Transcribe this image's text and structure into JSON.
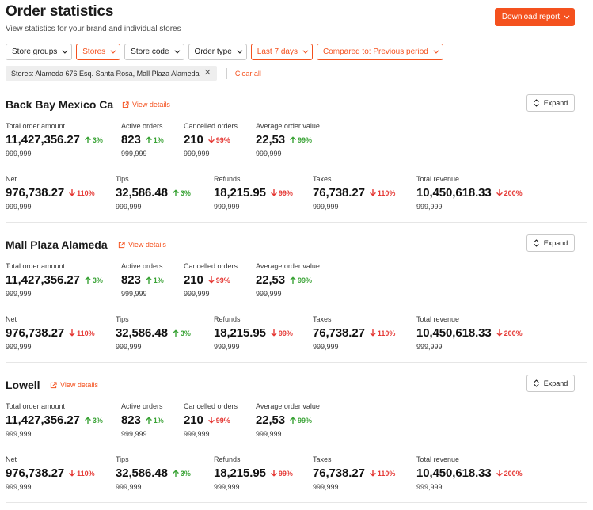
{
  "header": {
    "title": "Order statistics",
    "subtitle": "View statistics for your brand and individual stores",
    "download_label": "Download report"
  },
  "filters": [
    {
      "label": "Store groups",
      "active": false
    },
    {
      "label": "Stores",
      "active": true
    },
    {
      "label": "Store code",
      "active": false
    },
    {
      "label": "Order type",
      "active": false
    },
    {
      "label": "Last 7 days",
      "active": true
    },
    {
      "prefix": "Compared to:",
      "label": "Previous period",
      "active": true
    }
  ],
  "selected_chip": "Stores: Alameda 676 Esq. Santa Rosa, Mall Plaza Alameda",
  "clear_all_label": "Clear all",
  "view_details_label": "View details",
  "expand_label": "Expand",
  "colors": {
    "accent": "#f4511e",
    "positive": "#3aa336",
    "negative": "#e53935"
  },
  "stores": [
    {
      "name": "Back Bay Mexico Ca",
      "row1": [
        {
          "label": "Total order amount",
          "value": "11,427,356.27",
          "change": "3%",
          "dir": "up",
          "sub": "999,999"
        },
        {
          "label": "Active orders",
          "value": "823",
          "change": "1%",
          "dir": "up",
          "sub": "999,999"
        },
        {
          "label": "Cancelled orders",
          "value": "210",
          "change": "99%",
          "dir": "down",
          "sub": "999,999"
        },
        {
          "label": "Average order value",
          "value": "22,53",
          "change": "99%",
          "dir": "up",
          "sub": "999,999"
        }
      ],
      "row2": [
        {
          "label": "Net",
          "value": "976,738.27",
          "change": "110%",
          "dir": "down",
          "sub": "999,999"
        },
        {
          "label": "Tips",
          "value": "32,586.48",
          "change": "3%",
          "dir": "up",
          "sub": "999,999"
        },
        {
          "label": "Refunds",
          "value": "18,215.95",
          "change": "99%",
          "dir": "down",
          "sub": "999,999"
        },
        {
          "label": "Taxes",
          "value": "76,738.27",
          "change": "110%",
          "dir": "down",
          "sub": "999,999"
        },
        {
          "label": "Total revenue",
          "value": "10,450,618.33",
          "change": "200%",
          "dir": "down",
          "sub": "999,999"
        }
      ]
    },
    {
      "name": "Mall Plaza Alameda",
      "row1": [
        {
          "label": "Total order amount",
          "value": "11,427,356.27",
          "change": "3%",
          "dir": "up",
          "sub": "999,999"
        },
        {
          "label": "Active orders",
          "value": "823",
          "change": "1%",
          "dir": "up",
          "sub": "999,999"
        },
        {
          "label": "Cancelled orders",
          "value": "210",
          "change": "99%",
          "dir": "down",
          "sub": "999,999"
        },
        {
          "label": "Average order value",
          "value": "22,53",
          "change": "99%",
          "dir": "up",
          "sub": "999,999"
        }
      ],
      "row2": [
        {
          "label": "Net",
          "value": "976,738.27",
          "change": "110%",
          "dir": "down",
          "sub": "999,999"
        },
        {
          "label": "Tips",
          "value": "32,586.48",
          "change": "3%",
          "dir": "up",
          "sub": "999,999"
        },
        {
          "label": "Refunds",
          "value": "18,215.95",
          "change": "99%",
          "dir": "down",
          "sub": "999,999"
        },
        {
          "label": "Taxes",
          "value": "76,738.27",
          "change": "110%",
          "dir": "down",
          "sub": "999,999"
        },
        {
          "label": "Total revenue",
          "value": "10,450,618.33",
          "change": "200%",
          "dir": "down",
          "sub": "999,999"
        }
      ]
    },
    {
      "name": "Lowell",
      "row1": [
        {
          "label": "Total order amount",
          "value": "11,427,356.27",
          "change": "3%",
          "dir": "up",
          "sub": "999,999"
        },
        {
          "label": "Active orders",
          "value": "823",
          "change": "1%",
          "dir": "up",
          "sub": "999,999"
        },
        {
          "label": "Cancelled orders",
          "value": "210",
          "change": "99%",
          "dir": "down",
          "sub": "999,999"
        },
        {
          "label": "Average order value",
          "value": "22,53",
          "change": "99%",
          "dir": "up",
          "sub": "999,999"
        }
      ],
      "row2": [
        {
          "label": "Net",
          "value": "976,738.27",
          "change": "110%",
          "dir": "down",
          "sub": "999,999"
        },
        {
          "label": "Tips",
          "value": "32,586.48",
          "change": "3%",
          "dir": "up",
          "sub": "999,999"
        },
        {
          "label": "Refunds",
          "value": "18,215.95",
          "change": "99%",
          "dir": "down",
          "sub": "999,999"
        },
        {
          "label": "Taxes",
          "value": "76,738.27",
          "change": "110%",
          "dir": "down",
          "sub": "999,999"
        },
        {
          "label": "Total revenue",
          "value": "10,450,618.33",
          "change": "200%",
          "dir": "down",
          "sub": "999,999"
        }
      ]
    }
  ]
}
